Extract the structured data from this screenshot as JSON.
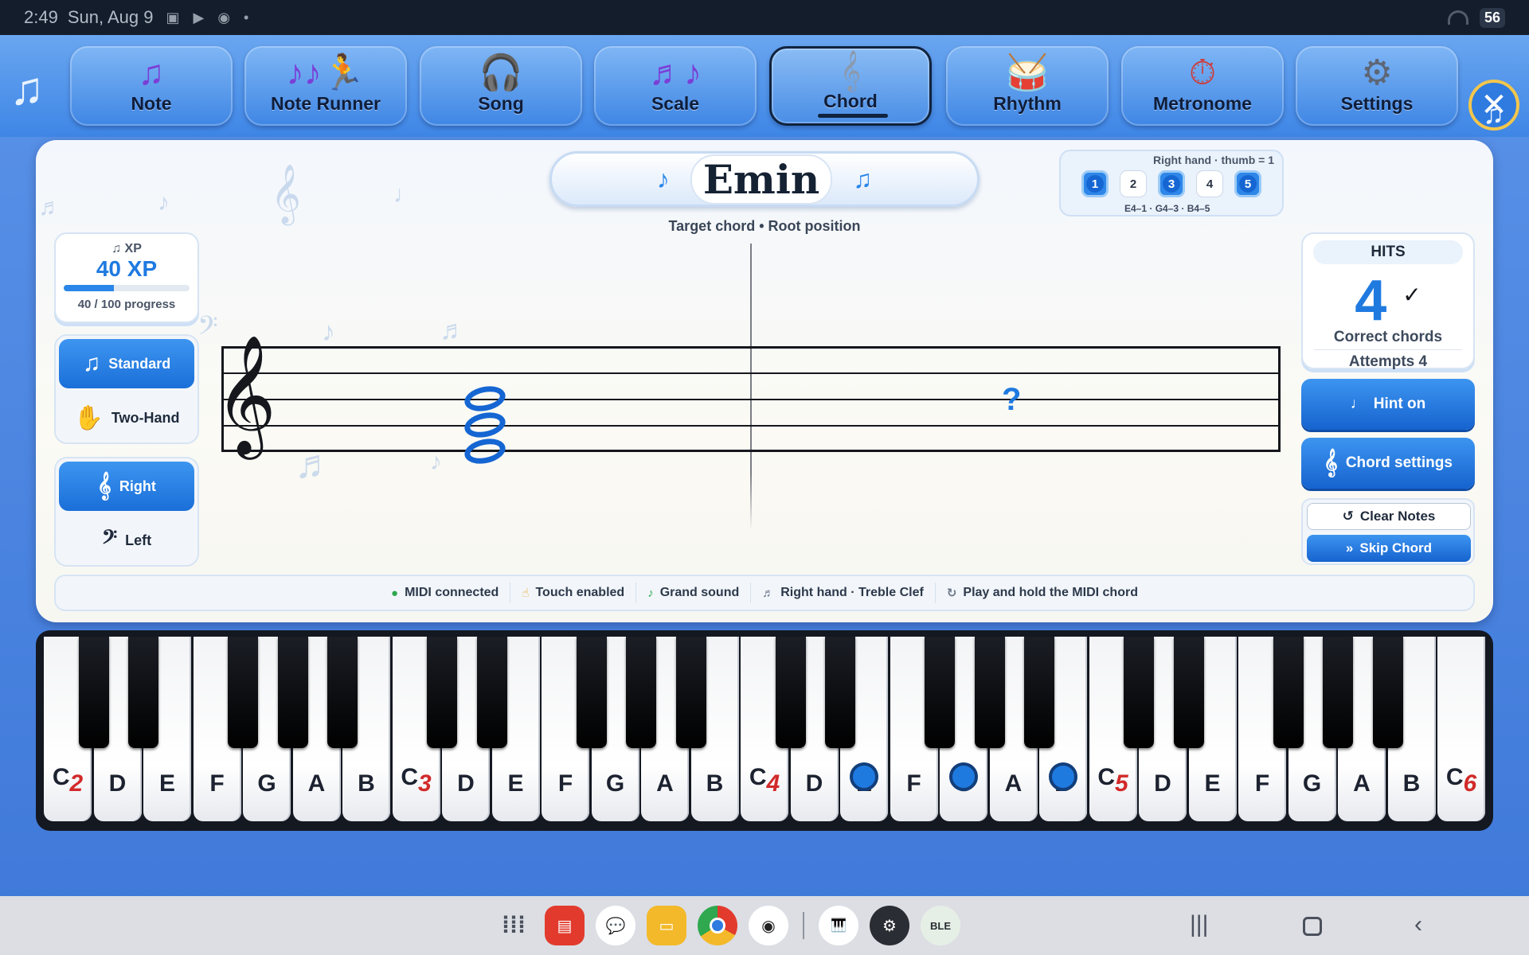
{
  "status_bar": {
    "time": "2:49",
    "date": "Sun, Aug 9",
    "battery": "56"
  },
  "tabs": [
    {
      "label": "Note",
      "icon": "music-note-icon"
    },
    {
      "label": "Note Runner",
      "icon": "runner-icon"
    },
    {
      "label": "Song",
      "icon": "headphones-icon"
    },
    {
      "label": "Scale",
      "icon": "notes-icon"
    },
    {
      "label": "Chord",
      "icon": "treble-clef-icon",
      "active": true
    },
    {
      "label": "Rhythm",
      "icon": "drum-icon"
    },
    {
      "label": "Metronome",
      "icon": "stopwatch-icon"
    },
    {
      "label": "Settings",
      "icon": "gear-icon"
    }
  ],
  "chord": {
    "name": "Emin",
    "subtitle": "Target chord • Root position"
  },
  "fingering": {
    "header": "Right hand · thumb = 1",
    "fingers": [
      "1",
      "2",
      "3",
      "4",
      "5"
    ],
    "active": [
      1,
      3,
      5
    ],
    "notes": "E4–1 · G4–3 · B4–5"
  },
  "xp": {
    "label": "♫ XP",
    "value": "40 XP",
    "progress": "40 / 100 progress",
    "fraction": 0.4
  },
  "mode": {
    "standard": "Standard",
    "two_hand": "Two-Hand",
    "selected": "Standard"
  },
  "hand": {
    "right": "Right",
    "left": "Left",
    "selected": "Right"
  },
  "hits": {
    "label": "HITS",
    "value": "4",
    "check": "✓",
    "caption": "Correct chords",
    "attempts": "Attempts 4"
  },
  "buttons": {
    "hint": "Hint on",
    "chord_settings": "Chord settings",
    "clear": "Clear Notes",
    "skip": "Skip Chord"
  },
  "status_chips": [
    {
      "icon": "●",
      "label": "MIDI connected"
    },
    {
      "icon": "☝",
      "label": "Touch enabled"
    },
    {
      "icon": "♪",
      "label": "Grand sound"
    },
    {
      "icon": "♬",
      "label": "Right hand · Treble Clef"
    },
    {
      "icon": "↻",
      "label": "Play and hold the MIDI chord"
    }
  ],
  "piano": {
    "white_keys": [
      "C",
      "D",
      "E",
      "F",
      "G",
      "A",
      "B",
      "C",
      "D",
      "E",
      "F",
      "G",
      "A",
      "B",
      "C",
      "D",
      "E",
      "F",
      "G",
      "A",
      "B",
      "C",
      "D",
      "E",
      "F",
      "G",
      "A",
      "B",
      "C"
    ],
    "octave_marks": {
      "0": "2",
      "7": "3",
      "14": "4",
      "21": "5",
      "28": "6"
    },
    "highlighted_keys": [
      "E4",
      "G4",
      "B4"
    ]
  },
  "colors": {
    "accent": "#1f7ae0",
    "octave_number": "#d22a2a",
    "frame": "#141821"
  }
}
